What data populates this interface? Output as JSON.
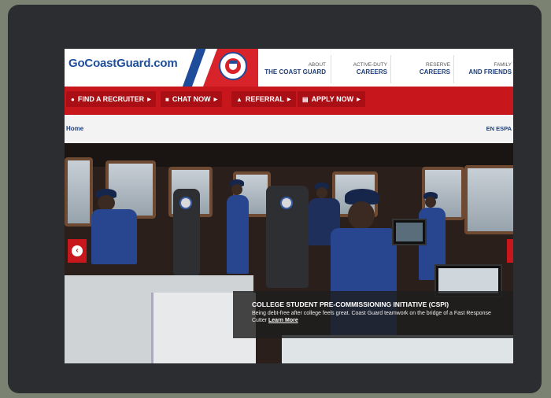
{
  "header": {
    "logo": "GoCoastGuard.com",
    "nav": [
      {
        "line1": "ABOUT",
        "line2": "THE COAST GUARD"
      },
      {
        "line1": "ACTIVE-DUTY",
        "line2": "CAREERS"
      },
      {
        "line1": "RESERVE",
        "line2": "CAREERS"
      },
      {
        "line1": "FAMILY",
        "line2": "AND FRIENDS"
      }
    ]
  },
  "actions": [
    {
      "icon": "location-pin-icon",
      "label": "FIND A RECRUITER"
    },
    {
      "icon": "chat-icon",
      "label": "CHAT NOW"
    },
    {
      "icon": "referral-icon",
      "label": "REFERRAL"
    },
    {
      "icon": "form-icon",
      "label": "APPLY NOW"
    }
  ],
  "breadcrumb": {
    "home": "Home",
    "language": "EN ESPA"
  },
  "hero": {
    "title": "COLLEGE STUDENT PRE-COMMISSIONING INITIATIVE (CSPI)",
    "description": "Being debt-free after college feels great. Coast Guard teamwork on the bridge of a Fast Response Cutter",
    "link": "Learn More"
  },
  "colors": {
    "brand_red": "#c8161d",
    "brand_blue": "#1e4c9a",
    "frame": "#2b2d30"
  }
}
